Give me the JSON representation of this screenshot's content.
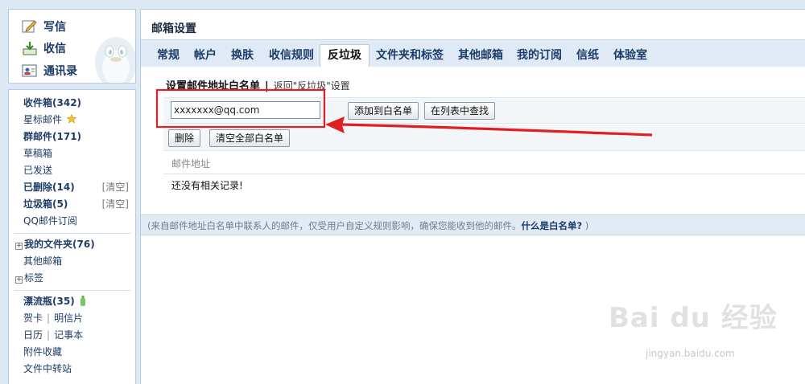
{
  "sidebar": {
    "quick": [
      {
        "label": "写信",
        "icon": "pencil-icon"
      },
      {
        "label": "收信",
        "icon": "inbox-download-icon"
      },
      {
        "label": "通讯录",
        "icon": "address-book-icon"
      }
    ],
    "folders": [
      {
        "name": "收件箱",
        "count": "(342)"
      },
      {
        "name": "星标邮件"
      },
      {
        "name": "群邮件",
        "count": "(171)"
      },
      {
        "name": "草稿箱"
      },
      {
        "name": "已发送"
      },
      {
        "name": "已删除",
        "count": "(14)",
        "action": "[清空]"
      },
      {
        "name": "垃圾箱",
        "count": "(5)",
        "action": "[清空]"
      },
      {
        "name": "QQ邮件订阅"
      }
    ],
    "my_folders": {
      "label": "我的文件夹",
      "count": "(76)"
    },
    "other_mailboxes": "其他邮箱",
    "tags": "标签",
    "apps": {
      "drift_bottle": {
        "label": "漂流瓶",
        "count": "(35)"
      },
      "greeting_card": "贺卡",
      "postcard": "明信片",
      "calendar": "日历",
      "notepad": "记事本",
      "attachments": "附件收藏",
      "file_transfer": "文件中转站"
    }
  },
  "main": {
    "title": "邮箱设置",
    "tabs": [
      "常规",
      "帐户",
      "换肤",
      "收信规则",
      "反垃圾",
      "文件夹和标签",
      "其他邮箱",
      "我的订阅",
      "信纸",
      "体验室"
    ],
    "active_tab": "反垃圾",
    "whitelist": {
      "title": "设置邮件地址白名单",
      "back_link": "返回\"反垃圾\"设置",
      "email_value": "xxxxxxx@qq.com",
      "add_button": "添加到白名单",
      "find_button": "在列表中查找",
      "delete_button": "删除",
      "clear_all_button": "清空全部白名单",
      "column_header": "邮件地址",
      "empty_message": "还没有相关记录!"
    },
    "footer_note": {
      "text": "(来自邮件地址白名单中联系人的邮件，仅受用户自定义规则影响，确保您能收到他的邮件。",
      "link": "什么是白名单?",
      "close": " )"
    }
  },
  "watermark": {
    "logo": "Bai du 经验",
    "url": "jingyan.baidu.com"
  },
  "colors": {
    "annotation_red": "#e02020",
    "tab_bar": "#dfeaf6",
    "page_bg": "#dce9f4"
  }
}
